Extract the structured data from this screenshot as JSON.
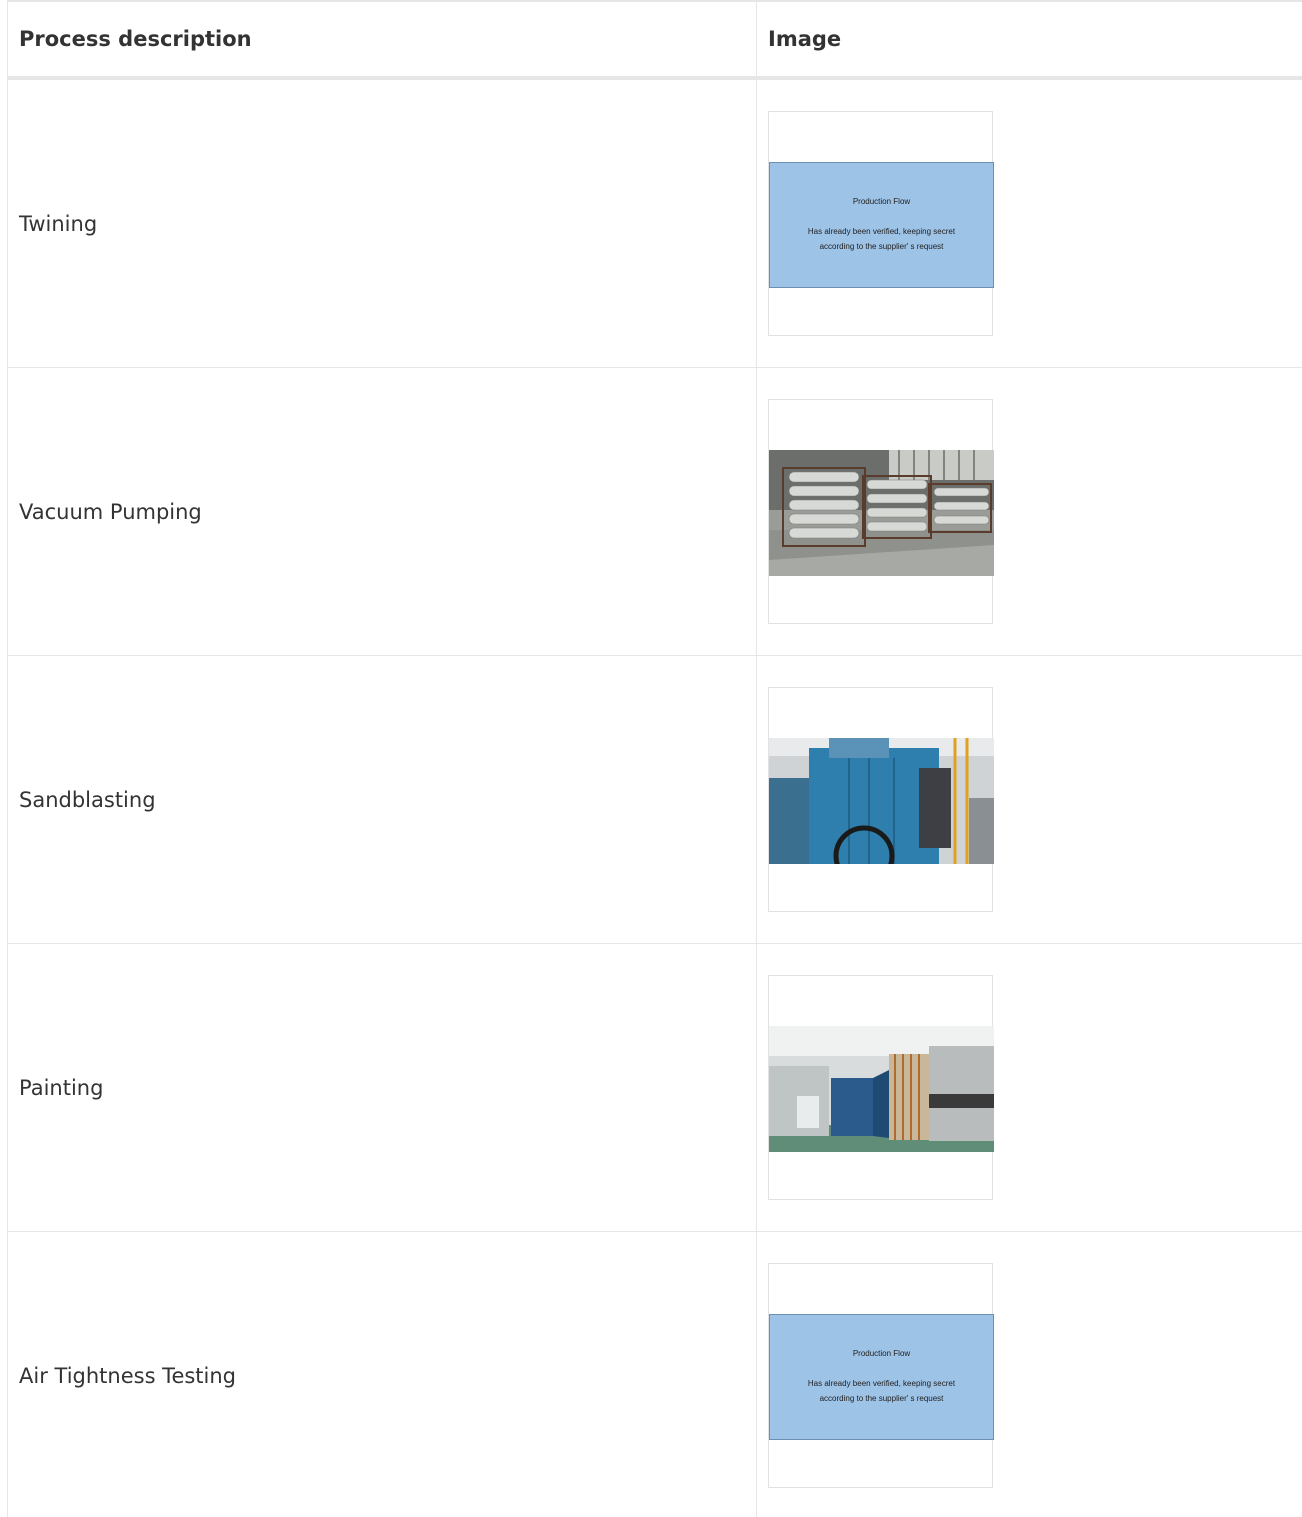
{
  "table": {
    "headers": [
      "Process description",
      "Image"
    ],
    "rows": [
      {
        "description": "Twining",
        "image": "placeholder"
      },
      {
        "description": "Vacuum Pumping",
        "image": "vacuum-photo"
      },
      {
        "description": "Sandblasting",
        "image": "sandblast-photo"
      },
      {
        "description": "Painting",
        "image": "painting-photo"
      },
      {
        "description": "Air Tightness Testing",
        "image": "placeholder"
      }
    ]
  },
  "placeholder": {
    "title": "Production Flow",
    "message": "Has already been verified, keeping secret according to the supplier' s request"
  }
}
